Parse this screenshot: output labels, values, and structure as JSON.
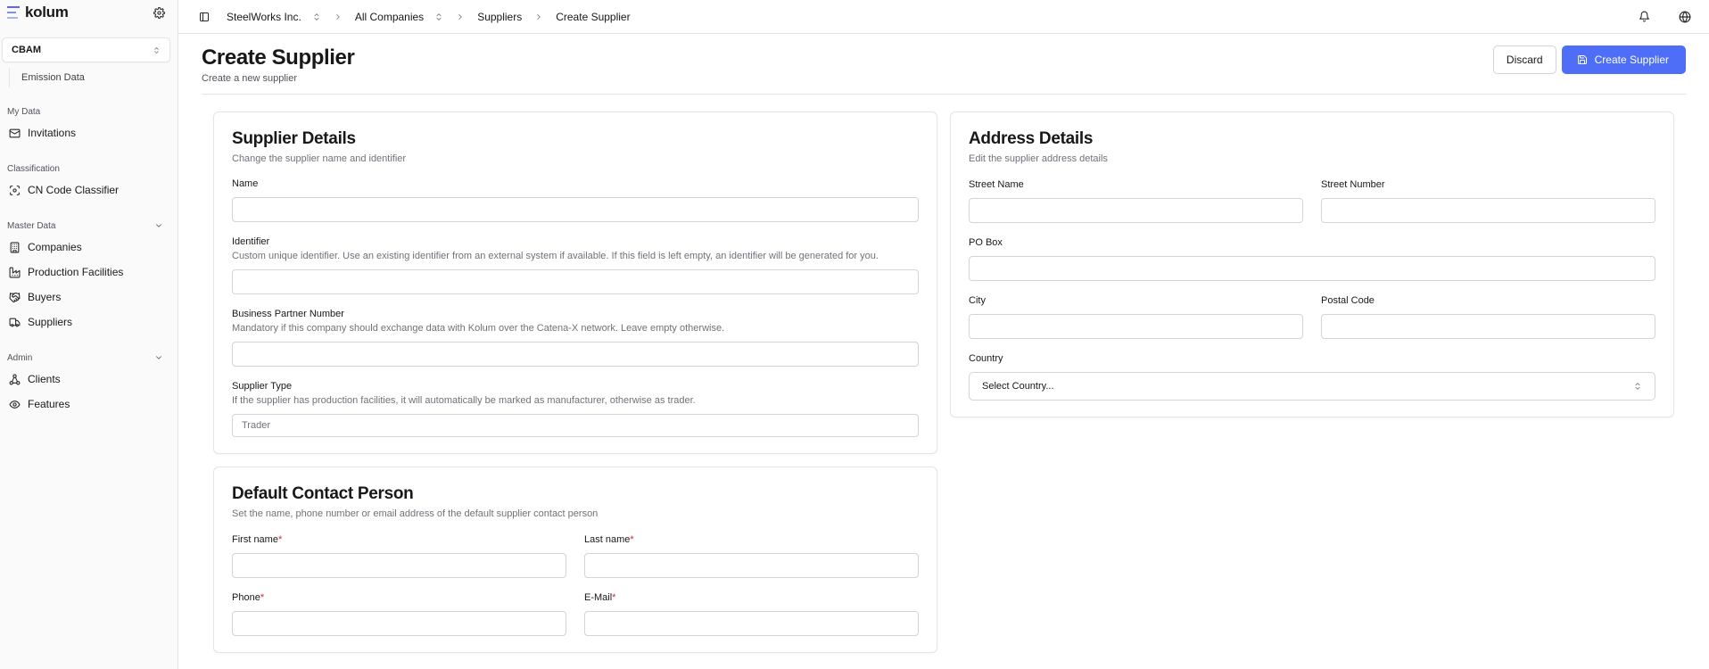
{
  "app": {
    "logo_text": "kolum"
  },
  "sidebar": {
    "module": "CBAM",
    "module_sub_item": "Emission Data",
    "sections": [
      {
        "label": "My Data",
        "items": [
          {
            "label": "Invitations",
            "icon": "mail-icon"
          }
        ]
      },
      {
        "label": "Classification",
        "items": [
          {
            "label": "CN Code Classifier",
            "icon": "scan-icon"
          }
        ]
      },
      {
        "label": "Master Data",
        "items": [
          {
            "label": "Companies",
            "icon": "building-icon"
          },
          {
            "label": "Production Facilities",
            "icon": "factory-icon"
          },
          {
            "label": "Buyers",
            "icon": "handshake-icon"
          },
          {
            "label": "Suppliers",
            "icon": "truck-icon"
          }
        ]
      },
      {
        "label": "Admin",
        "items": [
          {
            "label": "Clients",
            "icon": "network-icon"
          },
          {
            "label": "Features",
            "icon": "eye-icon"
          }
        ]
      }
    ]
  },
  "topbar": {
    "breadcrumbs": [
      "SteelWorks Inc.",
      "All Companies",
      "Suppliers",
      "Create Supplier"
    ]
  },
  "header": {
    "title": "Create Supplier",
    "subtitle": "Create a new supplier",
    "discard_label": "Discard",
    "create_label": "Create Supplier"
  },
  "supplier_details": {
    "title": "Supplier Details",
    "description": "Change the supplier name and identifier",
    "name_label": "Name",
    "name_value": "",
    "identifier_label": "Identifier",
    "identifier_help": "Custom unique identifier. Use an existing identifier from an external system if available. If this field is left empty, an identifier will be generated for you.",
    "identifier_value": "",
    "bpn_label": "Business Partner Number",
    "bpn_help": "Mandatory if this company should exchange data with Kolum over the Catena-X network. Leave empty otherwise.",
    "bpn_value": "",
    "type_label": "Supplier Type",
    "type_help": "If the supplier has production facilities, it will automatically be marked as manufacturer, otherwise as trader.",
    "type_placeholder": "Trader"
  },
  "contact": {
    "title": "Default Contact Person",
    "description": "Set the name, phone number or email address of the default supplier contact person",
    "first_name_label": "First name",
    "last_name_label": "Last name",
    "phone_label": "Phone",
    "email_label": "E-Mail",
    "required_mark": "*"
  },
  "address": {
    "title": "Address Details",
    "description": "Edit the supplier address details",
    "street_name_label": "Street Name",
    "street_number_label": "Street Number",
    "po_box_label": "PO Box",
    "city_label": "City",
    "postal_code_label": "Postal Code",
    "country_label": "Country",
    "country_placeholder": "Select Country..."
  },
  "colors": {
    "primary": "#4f6ef7",
    "required": "#dc2626",
    "border": "#e4e4e7"
  }
}
